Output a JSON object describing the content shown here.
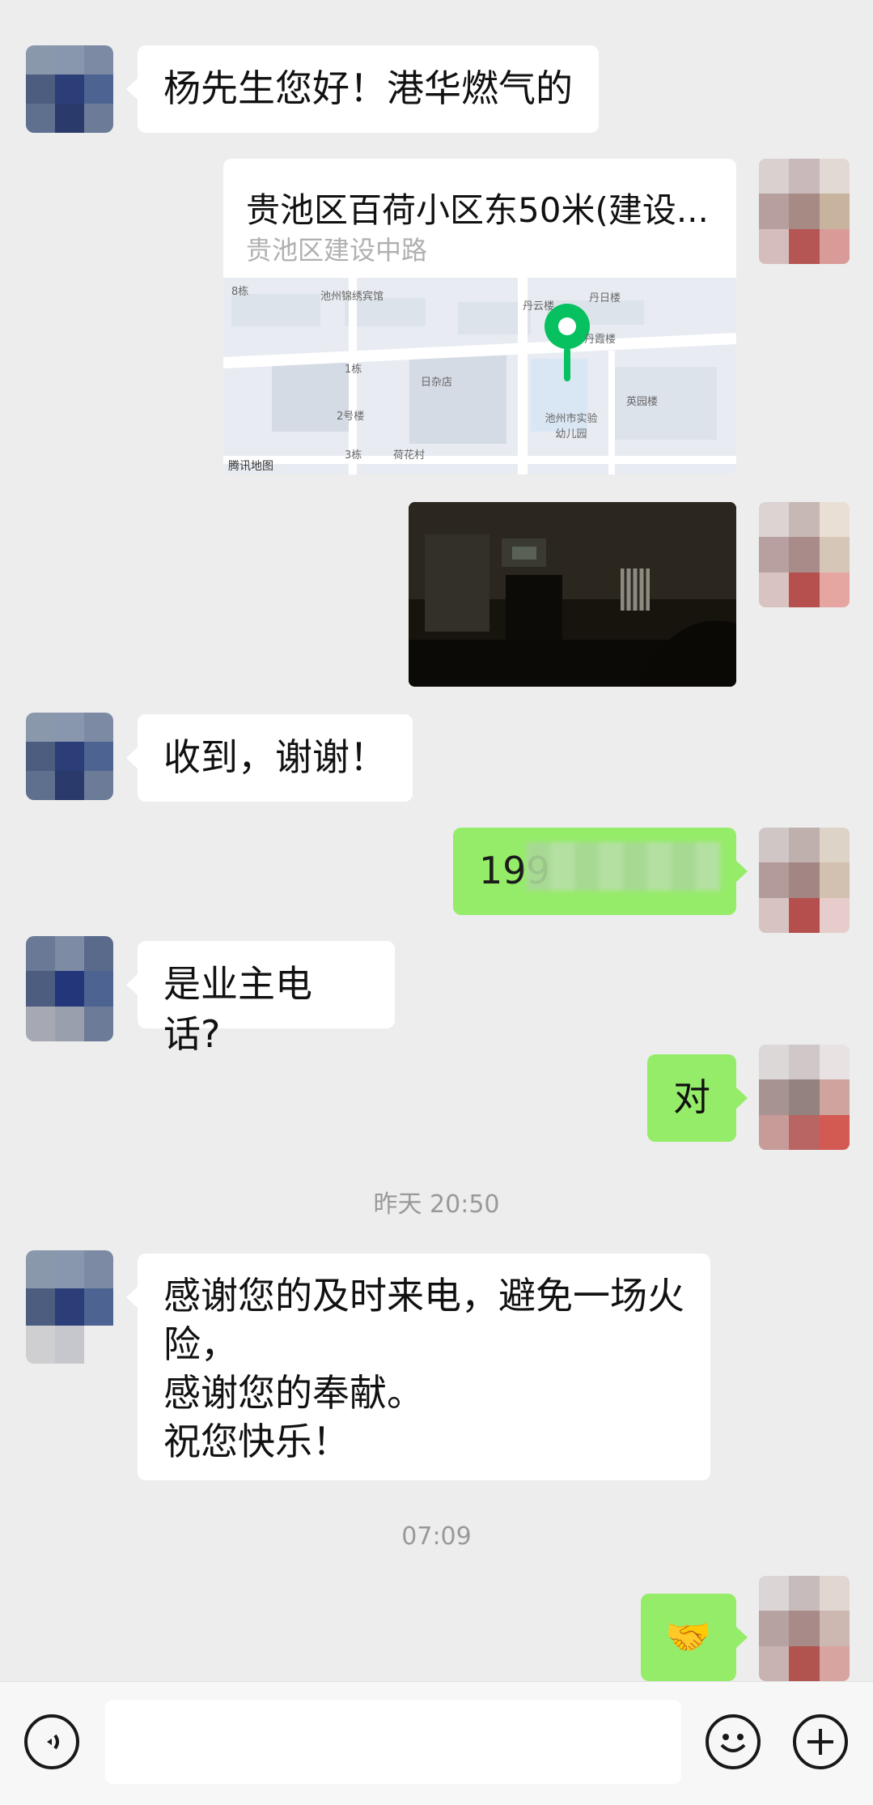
{
  "messages": {
    "m1": "杨先生您好！港华燃气的",
    "location": {
      "title": "贵池区百荷小区东50米(建设...",
      "subtitle": "贵池区建设中路",
      "map_labels": [
        "池州锦绣宾馆",
        "丹日楼",
        "丹云楼",
        "丹霞楼",
        "日杂店",
        "1栋",
        "2号楼",
        "3栋",
        "荷花村",
        "英园楼",
        "池州市实验幼儿园",
        "腾讯地图",
        "8栋"
      ]
    },
    "m3": "收到，谢谢！",
    "m4": "199",
    "m5": "是业主电话?",
    "m6": "对",
    "m8_lines": [
      "感谢您的及时来电，避免一场火",
      "险，",
      "感谢您的奉献。",
      "祝您快乐！"
    ],
    "m9": "🤝"
  },
  "timestamps": {
    "t1": "昨天 20:50",
    "t2": "07:09"
  },
  "colors": {
    "background": "#ededed",
    "sent_bubble": "#95ec69",
    "received_bubble": "#ffffff",
    "map_pin": "#07c160"
  },
  "icons": {
    "voice": "voice-icon",
    "emoji": "emoji-icon",
    "more": "plus-icon"
  }
}
